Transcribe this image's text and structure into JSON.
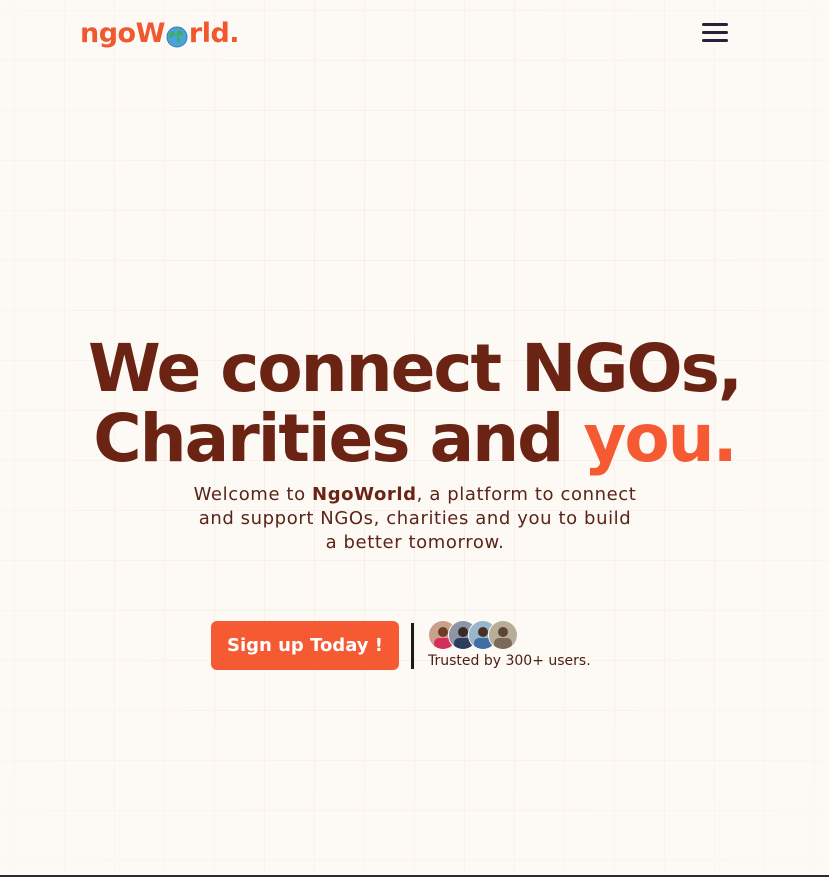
{
  "header": {
    "logo": {
      "prefix": "ngo",
      "suffix_w": "W",
      "suffix": "rld.",
      "globe_icon": "globe-icon"
    },
    "menu_icon": "hamburger-menu-icon"
  },
  "hero": {
    "title_line1": "We connect NGOs,",
    "title_line2_plain": "Charities and ",
    "title_line2_accent": "you."
  },
  "subtitle": {
    "before": "Welcome to ",
    "brand": "NgoWorld",
    "after": ", a platform to connect and support NGOs, charities and you to build a better tomorrow."
  },
  "cta": {
    "signup_label": "Sign up Today !",
    "trusted_text": "Trusted by 300+ users.",
    "avatars": [
      "user-avatar-1",
      "user-avatar-2",
      "user-avatar-3",
      "user-avatar-4"
    ]
  },
  "colors": {
    "accent": "#f55a33",
    "heading": "#6b2314",
    "background": "#fdf9f5",
    "menu": "#22223b"
  }
}
